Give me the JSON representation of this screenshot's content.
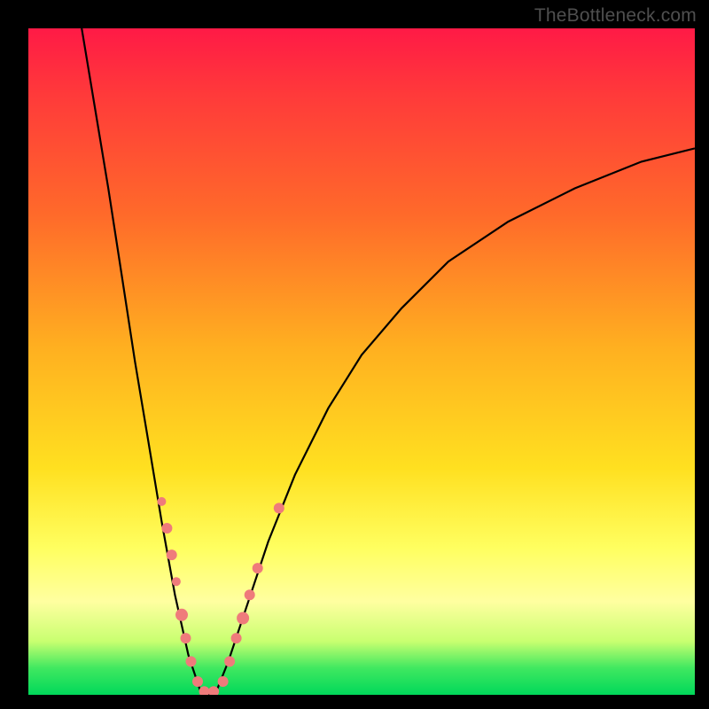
{
  "watermark": "TheBottleneck.com",
  "chart_data": {
    "type": "line",
    "title": "",
    "xlabel": "",
    "ylabel": "",
    "xlim": [
      0,
      100
    ],
    "ylim": [
      0,
      100
    ],
    "grid": false,
    "curve": {
      "description": "V-shaped bottleneck curve; minimum near x≈26 at y≈0, rising steeply to y≈100 at x≈8 (left) and gradually to y≈82 at x≈100 (right).",
      "points": [
        {
          "x": 8,
          "y": 100
        },
        {
          "x": 10,
          "y": 88
        },
        {
          "x": 12,
          "y": 76
        },
        {
          "x": 14,
          "y": 63
        },
        {
          "x": 16,
          "y": 50
        },
        {
          "x": 18,
          "y": 38
        },
        {
          "x": 20,
          "y": 26
        },
        {
          "x": 22,
          "y": 15
        },
        {
          "x": 24,
          "y": 6
        },
        {
          "x": 26,
          "y": 0
        },
        {
          "x": 28,
          "y": 0
        },
        {
          "x": 30,
          "y": 5
        },
        {
          "x": 33,
          "y": 14
        },
        {
          "x": 36,
          "y": 23
        },
        {
          "x": 40,
          "y": 33
        },
        {
          "x": 45,
          "y": 43
        },
        {
          "x": 50,
          "y": 51
        },
        {
          "x": 56,
          "y": 58
        },
        {
          "x": 63,
          "y": 65
        },
        {
          "x": 72,
          "y": 71
        },
        {
          "x": 82,
          "y": 76
        },
        {
          "x": 92,
          "y": 80
        },
        {
          "x": 100,
          "y": 82
        }
      ]
    },
    "series": [
      {
        "name": "data-points",
        "type": "scatter",
        "values": [
          {
            "x": 20.0,
            "y": 29.0,
            "r": 5
          },
          {
            "x": 20.8,
            "y": 25.0,
            "r": 6
          },
          {
            "x": 21.5,
            "y": 21.0,
            "r": 6
          },
          {
            "x": 22.2,
            "y": 17.0,
            "r": 5
          },
          {
            "x": 23.0,
            "y": 12.0,
            "r": 7
          },
          {
            "x": 23.6,
            "y": 8.5,
            "r": 6
          },
          {
            "x": 24.4,
            "y": 5.0,
            "r": 6
          },
          {
            "x": 25.4,
            "y": 2.0,
            "r": 6
          },
          {
            "x": 26.4,
            "y": 0.5,
            "r": 6
          },
          {
            "x": 27.8,
            "y": 0.5,
            "r": 6
          },
          {
            "x": 29.2,
            "y": 2.0,
            "r": 6
          },
          {
            "x": 30.2,
            "y": 5.0,
            "r": 6
          },
          {
            "x": 31.2,
            "y": 8.5,
            "r": 6
          },
          {
            "x": 32.2,
            "y": 11.5,
            "r": 7
          },
          {
            "x": 33.2,
            "y": 15.0,
            "r": 6
          },
          {
            "x": 34.4,
            "y": 19.0,
            "r": 6
          },
          {
            "x": 37.6,
            "y": 28.0,
            "r": 6
          }
        ]
      }
    ],
    "background": {
      "type": "vertical-gradient",
      "stops": [
        {
          "pos": 0.0,
          "color": "#ff1a46"
        },
        {
          "pos": 0.3,
          "color": "#ff6a2a"
        },
        {
          "pos": 0.6,
          "color": "#ffd020"
        },
        {
          "pos": 0.82,
          "color": "#ffff80"
        },
        {
          "pos": 1.0,
          "color": "#00d85a"
        }
      ]
    }
  }
}
